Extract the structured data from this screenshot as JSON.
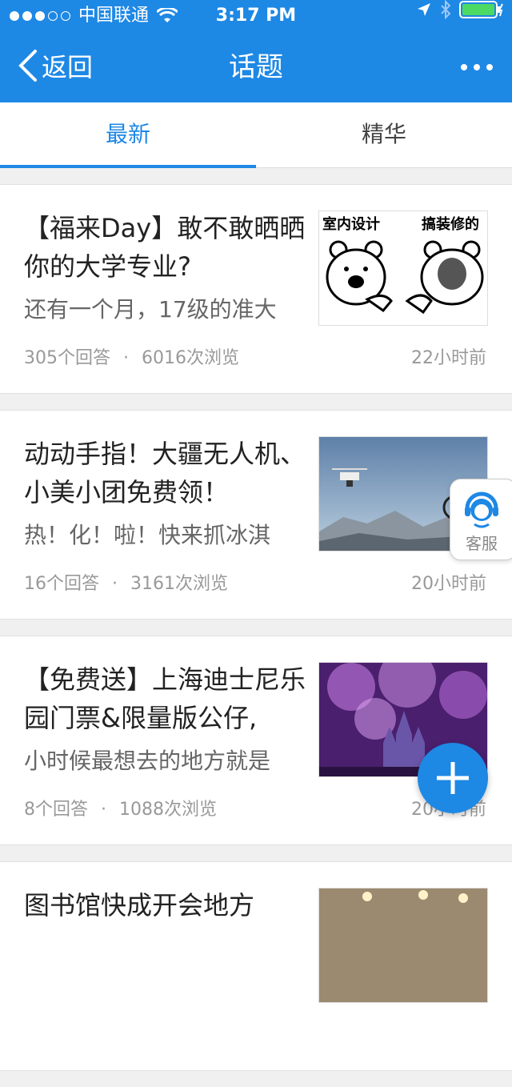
{
  "status": {
    "carrier": "中国联通",
    "time": "3:17 PM"
  },
  "nav": {
    "back_label": "返回",
    "title": "话题"
  },
  "tabs": [
    {
      "label": "最新",
      "active": true
    },
    {
      "label": "精华",
      "active": false
    }
  ],
  "topics": [
    {
      "title": "【福来Day】敢不敢晒晒你的大学专业?",
      "subtitle": "还有一个月，17级的准大",
      "answers": "305个回答",
      "views": "6016次浏览",
      "time": "22小时前",
      "thumb_text_left": "室内设计",
      "thumb_text_right": "搞装修的"
    },
    {
      "title": "动动手指！大疆无人机、小美小团免费领！",
      "subtitle": "热！化！啦！快来抓冰淇",
      "answers": "16个回答",
      "views": "3161次浏览",
      "time": "20小时前"
    },
    {
      "title": "【免费送】上海迪士尼乐园门票&限量版公仔,",
      "subtitle": "小时候最想去的地方就是",
      "answers": "8个回答",
      "views": "1088次浏览",
      "time": "20小时前"
    },
    {
      "title": "图书馆快成开会地方",
      "subtitle": "",
      "answers": "",
      "views": "",
      "time": ""
    }
  ],
  "service": {
    "label": "客服"
  },
  "meta_separator": "·",
  "colors": {
    "accent": "#1e88e5",
    "background": "#f0f0f0"
  }
}
